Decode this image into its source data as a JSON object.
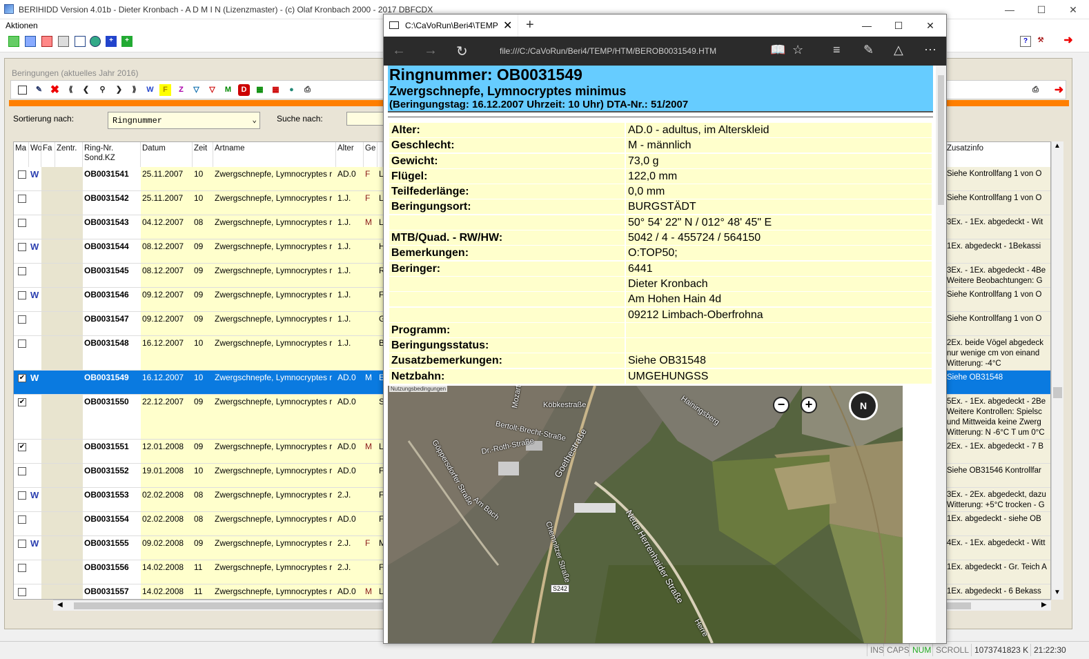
{
  "main_window": {
    "title": "BERIHIDD Version 4.01b - Dieter Kronbach - A D M I N (Lizenzmaster) - (c) Olaf Kronbach 2000 - 2017 DBFCDX",
    "menu": [
      "Aktionen"
    ]
  },
  "panel": {
    "title": "Beringungen (aktuelles Jahr 2016)",
    "sort_label": "Sortierung nach:",
    "sort_value": "Ringnummer",
    "search_label": "Suche nach:",
    "search_value": ""
  },
  "grid": {
    "headers": {
      "ma": "Ma",
      "wo": "Wo",
      "fa": "Fa",
      "zentr": "Zentr.",
      "ring": "Ring-Nr.\nSond.KZ",
      "datum": "Datum",
      "zeit": "Zeit",
      "artname": "Artname",
      "alter": "Alter",
      "ge": "Ge",
      "zusatz": "Zusatzinfo"
    },
    "rows": [
      {
        "checked": false,
        "w": true,
        "ring": "OB0031541",
        "datum": "25.11.2007",
        "zeit": "10",
        "art": "Zwergschnepfe, Lymnocryptes r",
        "alter": "AD.0",
        "ge": "F",
        "x": "L",
        "zusatz": [
          "Siehe Kontrollfang 1 von O"
        ],
        "selected": false
      },
      {
        "checked": false,
        "w": false,
        "ring": "OB0031542",
        "datum": "25.11.2007",
        "zeit": "10",
        "art": "Zwergschnepfe, Lymnocryptes r",
        "alter": "1.J.",
        "ge": "F",
        "x": "L",
        "zusatz": [
          "Siehe Kontrollfang 1 von O"
        ],
        "selected": false
      },
      {
        "checked": false,
        "w": false,
        "ring": "OB0031543",
        "datum": "04.12.2007",
        "zeit": "08",
        "art": "Zwergschnepfe, Lymnocryptes r",
        "alter": "1.J.",
        "ge": "M",
        "x": "L",
        "zusatz": [
          "3Ex. - 1Ex. abgedeckt - Wit"
        ],
        "selected": false
      },
      {
        "checked": false,
        "w": true,
        "ring": "OB0031544",
        "datum": "08.12.2007",
        "zeit": "09",
        "art": "Zwergschnepfe, Lymnocryptes r",
        "alter": "1.J.",
        "ge": "",
        "x": "H",
        "zusatz": [
          "1Ex. abgedeckt - 1Bekassi"
        ],
        "selected": false
      },
      {
        "checked": false,
        "w": false,
        "ring": "OB0031545",
        "datum": "08.12.2007",
        "zeit": "09",
        "art": "Zwergschnepfe, Lymnocryptes r",
        "alter": "1.J.",
        "ge": "",
        "x": "R",
        "zusatz": [
          "3Ex. - 1Ex. abgedeckt - 4Be",
          "Weitere Beobachtungen: G"
        ],
        "selected": false
      },
      {
        "checked": false,
        "w": true,
        "ring": "OB0031546",
        "datum": "09.12.2007",
        "zeit": "09",
        "art": "Zwergschnepfe, Lymnocryptes r",
        "alter": "1.J.",
        "ge": "",
        "x": "F",
        "zusatz": [
          "Siehe Kontrollfang 1 von O"
        ],
        "selected": false
      },
      {
        "checked": false,
        "w": false,
        "ring": "OB0031547",
        "datum": "09.12.2007",
        "zeit": "09",
        "art": "Zwergschnepfe, Lymnocryptes r",
        "alter": "1.J.",
        "ge": "",
        "x": "G",
        "zusatz": [
          "Siehe Kontrollfang 1 von O"
        ],
        "selected": false
      },
      {
        "checked": false,
        "w": false,
        "ring": "OB0031548",
        "datum": "16.12.2007",
        "zeit": "10",
        "art": "Zwergschnepfe, Lymnocryptes r",
        "alter": "1.J.",
        "ge": "",
        "x": "B",
        "zusatz": [
          "2Ex. beide Vögel abgedeck",
          "nur wenige cm von einand",
          "Witterung: -4°C"
        ],
        "selected": false
      },
      {
        "checked": true,
        "w": true,
        "ring": "OB0031549",
        "datum": "16.12.2007",
        "zeit": "10",
        "art": "Zwergschnepfe, Lymnocryptes r",
        "alter": "AD.0",
        "ge": "M",
        "x": "E",
        "zusatz": [
          "Siehe OB31548"
        ],
        "selected": true
      },
      {
        "checked": true,
        "w": false,
        "ring": "OB0031550",
        "datum": "22.12.2007",
        "zeit": "09",
        "art": "Zwergschnepfe, Lymnocryptes r",
        "alter": "AD.0",
        "ge": "",
        "x": "S",
        "zusatz": [
          "5Ex. - 1Ex. abgedeckt - 2Be",
          "Weitere Kontrollen: Spielsc",
          "und Mittweida keine Zwerg",
          "Witterung: N -6°C T um 0°C"
        ],
        "selected": false
      },
      {
        "checked": true,
        "w": false,
        "ring": "OB0031551",
        "datum": "12.01.2008",
        "zeit": "09",
        "art": "Zwergschnepfe, Lymnocryptes r",
        "alter": "AD.0",
        "ge": "M",
        "x": "L",
        "zusatz": [
          "2Ex. - 1Ex. abgedeckt - 7 B"
        ],
        "selected": false
      },
      {
        "checked": false,
        "w": false,
        "ring": "OB0031552",
        "datum": "19.01.2008",
        "zeit": "10",
        "art": "Zwergschnepfe, Lymnocryptes r",
        "alter": "AD.0",
        "ge": "",
        "x": "F",
        "zusatz": [
          "Siehe OB31546 Kontrollfar"
        ],
        "selected": false
      },
      {
        "checked": false,
        "w": true,
        "ring": "OB0031553",
        "datum": "02.02.2008",
        "zeit": "08",
        "art": "Zwergschnepfe, Lymnocryptes r",
        "alter": "2.J.",
        "ge": "",
        "x": "F",
        "zusatz": [
          "3Ex. - 2Ex. abgedeckt, dazu",
          "Witterung: +5°C trocken - G"
        ],
        "selected": false
      },
      {
        "checked": false,
        "w": false,
        "ring": "OB0031554",
        "datum": "02.02.2008",
        "zeit": "08",
        "art": "Zwergschnepfe, Lymnocryptes r",
        "alter": "AD.0",
        "ge": "",
        "x": "F",
        "zusatz": [
          "1Ex. abgedeckt - siehe OB"
        ],
        "selected": false
      },
      {
        "checked": false,
        "w": true,
        "ring": "OB0031555",
        "datum": "09.02.2008",
        "zeit": "09",
        "art": "Zwergschnepfe, Lymnocryptes r",
        "alter": "2.J.",
        "ge": "F",
        "x": "M",
        "zusatz": [
          "4Ex. - 1Ex. abgedeckt - Witt"
        ],
        "selected": false
      },
      {
        "checked": false,
        "w": false,
        "ring": "OB0031556",
        "datum": "14.02.2008",
        "zeit": "11",
        "art": "Zwergschnepfe, Lymnocryptes r",
        "alter": "2.J.",
        "ge": "",
        "x": "F",
        "zusatz": [
          "1Ex. abgedeckt - Gr. Teich A"
        ],
        "selected": false
      },
      {
        "checked": false,
        "w": false,
        "ring": "OB0031557",
        "datum": "14.02.2008",
        "zeit": "11",
        "art": "Zwergschnepfe, Lymnocryptes r",
        "alter": "AD.0",
        "ge": "M",
        "x": "L",
        "zusatz": [
          "1Ex. abgedeckt - 6 Bekass"
        ],
        "selected": false
      }
    ]
  },
  "statusbar": {
    "ins": "INS",
    "caps": "CAPS",
    "num": "NUM",
    "scroll": "SCROLL",
    "memory": "1073741823 K",
    "time": "21:22:30"
  },
  "browser": {
    "tab_title": "C:\\CaVoRun\\Beri4\\TEMP",
    "url": "file:///C:/CaVoRun/Beri4/TEMP/HTM/BEROB0031549.HTM",
    "heading": "Ringnummer: OB0031549",
    "species": "Zwergschnepfe, Lymnocryptes minimus",
    "subheading": "(Beringungstag: 16.12.2007 Uhrzeit: 10 Uhr) DTA-Nr.: 51/2007",
    "details": [
      {
        "key": "Alter:",
        "value": "AD.0 - adultus, im Alterskleid"
      },
      {
        "key": "Geschlecht:",
        "value": "M - männlich"
      },
      {
        "key": "Gewicht:",
        "value": "73,0 g"
      },
      {
        "key": "Flügel:",
        "value": "122,0 mm"
      },
      {
        "key": "Teilfederlänge:",
        "value": "0,0 mm"
      },
      {
        "key": "Beringungsort:",
        "value": "BURGSTÄDT"
      },
      {
        "key": "",
        "value": "50° 54' 22\" N / 012° 48' 45\" E"
      },
      {
        "key": "MTB/Quad. - RW/HW:",
        "value": "5042 / 4 - 455724 / 564150"
      },
      {
        "key": "Bemerkungen:",
        "value": "O:TOP50;"
      },
      {
        "key": "Beringer:",
        "value": "6441"
      },
      {
        "key": "",
        "value": "Dieter Kronbach"
      },
      {
        "key": "",
        "value": "Am Hohen Hain 4d"
      },
      {
        "key": "",
        "value": "09212 Limbach-Oberfrohna"
      },
      {
        "key": "Programm:",
        "value": ""
      },
      {
        "key": "Beringungsstatus:",
        "value": ""
      },
      {
        "key": "Zusatzbemerkungen:",
        "value": "Siehe OB31548"
      },
      {
        "key": "Netzbahn:",
        "value": "UMGEHUNGSS"
      }
    ],
    "map": {
      "legal": "Nutzungsbedingungen",
      "labels": [
        "Köbkestraße",
        "Hainingsberg",
        "Bertolt-Brecht-Straße",
        "Dr.-Roth-Straße",
        "Goethestraße",
        "Göppersdorfer Straße",
        "Am Bach",
        "Neue Herrenhaider Straße",
        "Chemnitzer Straße",
        "S242",
        "Herre",
        "Mozart"
      ],
      "compass": "N"
    }
  }
}
